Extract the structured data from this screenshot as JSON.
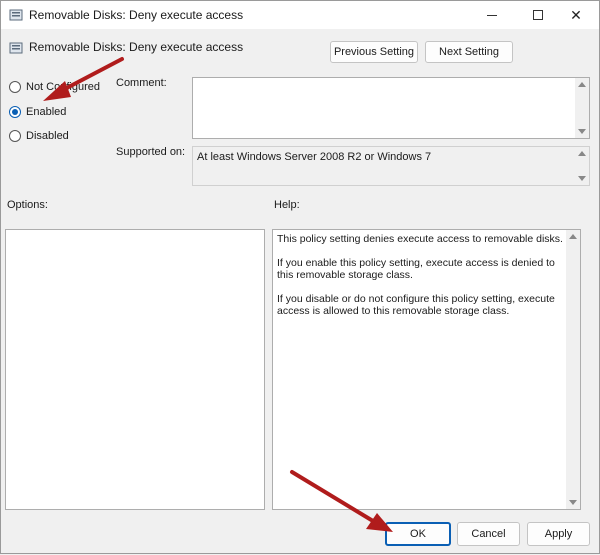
{
  "window": {
    "title": "Removable Disks: Deny execute access"
  },
  "header": {
    "title": "Removable Disks: Deny execute access",
    "previous_label": "Previous Setting",
    "next_label": "Next Setting"
  },
  "state": {
    "options": [
      {
        "label": "Not Configured",
        "checked": false
      },
      {
        "label": "Enabled",
        "checked": true
      },
      {
        "label": "Disabled",
        "checked": false
      }
    ]
  },
  "comment": {
    "label": "Comment:",
    "value": ""
  },
  "supported": {
    "label": "Supported on:",
    "value": "At least Windows Server 2008 R2 or Windows 7"
  },
  "options_panel": {
    "label": "Options:"
  },
  "help_panel": {
    "label": "Help:",
    "paragraphs": [
      "This policy setting denies execute access to removable disks.",
      "If you enable this policy setting, execute access is denied to this removable storage class.",
      "If you disable or do not configure this policy setting, execute access is allowed to this removable storage class."
    ]
  },
  "footer": {
    "ok_label": "OK",
    "cancel_label": "Cancel",
    "apply_label": "Apply"
  },
  "annotation": {
    "arrow_color": "#b01c1c"
  },
  "colors": {
    "accent": "#0a5fb4"
  }
}
